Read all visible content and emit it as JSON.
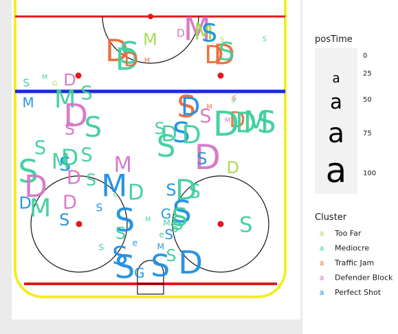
{
  "chart_data": {
    "type": "scatter",
    "title": "",
    "xlabel": "",
    "ylabel": "",
    "xlim": [
      -42.5,
      42.5
    ],
    "ylim": [
      0,
      100
    ],
    "grid": false,
    "legend_position": "right",
    "size_legend": {
      "title": "posTime",
      "breaks": [
        "0",
        "25",
        "50",
        "75",
        "100"
      ],
      "glyph": "a"
    },
    "color_legend": {
      "title": "Cluster",
      "glyph": "a",
      "entries": [
        {
          "name": "Too Far",
          "color": "#a3d94b"
        },
        {
          "name": "Mediocre",
          "color": "#3fcf9c"
        },
        {
          "name": "Traffic Jam",
          "color": "#ea6b37"
        },
        {
          "name": "Defender Block",
          "color": "#d575c6"
        },
        {
          "name": "Perfect Shot",
          "color": "#1f8ee0"
        }
      ]
    },
    "points": [
      {
        "x": -39.0,
        "y": 74.0,
        "label": "S",
        "cluster": "Mediocre",
        "posTime": 18
      },
      {
        "x": -33.2,
        "y": 75.8,
        "label": "M",
        "cluster": "Mediocre",
        "posTime": 4
      },
      {
        "x": -38.4,
        "y": 67.8,
        "label": "M",
        "cluster": "Perfect Shot",
        "posTime": 28
      },
      {
        "x": -25.3,
        "y": 75.0,
        "label": "D",
        "cluster": "Defender Block",
        "posTime": 38
      },
      {
        "x": -20.0,
        "y": 70.7,
        "label": "S",
        "cluster": "Mediocre",
        "posTime": 46
      },
      {
        "x": -26.8,
        "y": 69.0,
        "label": "M",
        "cluster": "Mediocre",
        "posTime": 68
      },
      {
        "x": -23.4,
        "y": 63.9,
        "label": "D",
        "cluster": "Defender Block",
        "posTime": 92
      },
      {
        "x": -18.0,
        "y": 60.2,
        "label": "S",
        "cluster": "Mediocre",
        "posTime": 78
      },
      {
        "x": -25.3,
        "y": 59.6,
        "label": "S",
        "cluster": "Defender Block",
        "posTime": 38
      },
      {
        "x": -34.6,
        "y": 53.7,
        "label": "S",
        "cluster": "Mediocre",
        "posTime": 46
      },
      {
        "x": -28.2,
        "y": 49.3,
        "label": "M",
        "cluster": "Mediocre",
        "posTime": 54
      },
      {
        "x": -26.8,
        "y": 48.5,
        "label": "S",
        "cluster": "Perfect Shot",
        "posTime": 46
      },
      {
        "x": -25.3,
        "y": 50.8,
        "label": "D",
        "cluster": "Mediocre",
        "posTime": 60
      },
      {
        "x": -20.0,
        "y": 51.4,
        "label": "S",
        "cluster": "Mediocre",
        "posTime": 46
      },
      {
        "x": -38.4,
        "y": 46.3,
        "label": "S",
        "cluster": "Mediocre",
        "posTime": 92
      },
      {
        "x": -36.0,
        "y": 41.5,
        "label": "D",
        "cluster": "Defender Block",
        "posTime": 86
      },
      {
        "x": -24.0,
        "y": 44.3,
        "label": "D",
        "cluster": "Defender Block",
        "posTime": 46
      },
      {
        "x": -18.6,
        "y": 43.7,
        "label": "S",
        "cluster": "Mediocre",
        "posTime": 38
      },
      {
        "x": -8.6,
        "y": 48.3,
        "label": "M",
        "cluster": "Defender Block",
        "posTime": 54
      },
      {
        "x": -11.3,
        "y": 41.7,
        "label": "M",
        "cluster": "Perfect Shot",
        "posTime": 86
      },
      {
        "x": -39.3,
        "y": 36.4,
        "label": "D",
        "cluster": "Perfect Shot",
        "posTime": 38
      },
      {
        "x": -34.6,
        "y": 34.9,
        "label": "M",
        "cluster": "Mediocre",
        "posTime": 68
      },
      {
        "x": -25.3,
        "y": 36.6,
        "label": "D",
        "cluster": "Defender Block",
        "posTime": 46
      },
      {
        "x": -27.0,
        "y": 31.2,
        "label": "S",
        "cluster": "Perfect Shot",
        "posTime": 38
      },
      {
        "x": -16.0,
        "y": 35.0,
        "label": "S",
        "cluster": "Perfect Shot",
        "posTime": 18
      },
      {
        "x": -4.5,
        "y": 39.6,
        "label": "D",
        "cluster": "Mediocre",
        "posTime": 54
      },
      {
        "x": -8.0,
        "y": 31.1,
        "label": "S",
        "cluster": "Perfect Shot",
        "posTime": 92
      },
      {
        "x": -9.3,
        "y": 27.0,
        "label": "S",
        "cluster": "Mediocre",
        "posTime": 38
      },
      {
        "x": -15.4,
        "y": 22.6,
        "label": "S",
        "cluster": "Mediocre",
        "posTime": 10
      },
      {
        "x": -9.5,
        "y": 20.0,
        "label": "S",
        "cluster": "Perfect Shot",
        "posTime": 68
      },
      {
        "x": -8.0,
        "y": 16.5,
        "label": "S",
        "cluster": "Perfect Shot",
        "posTime": 92
      },
      {
        "x": -4.8,
        "y": 24.0,
        "label": "e",
        "cluster": "Perfect Shot",
        "posTime": 10
      },
      {
        "x": -3.4,
        "y": 14.5,
        "label": "G",
        "cluster": "Perfect Shot",
        "posTime": 28
      },
      {
        "x": -0.7,
        "y": 31.2,
        "label": "M",
        "cluster": "Mediocre",
        "posTime": 4
      },
      {
        "x": -11.0,
        "y": 39.0,
        "label": "e",
        "cluster": "Mediocre",
        "posTime": 4
      },
      {
        "x": 0.0,
        "y": 87.6,
        "label": "M",
        "cluster": "Too Far",
        "posTime": 38
      },
      {
        "x": 9.6,
        "y": 89.6,
        "label": "D",
        "cluster": "Defender Block",
        "posTime": 18
      },
      {
        "x": 14.8,
        "y": 90.9,
        "label": "M",
        "cluster": "Defender Block",
        "posTime": 92
      },
      {
        "x": 16.8,
        "y": 90.1,
        "label": "M",
        "cluster": "Too Far",
        "posTime": 60
      },
      {
        "x": 18.6,
        "y": 89.7,
        "label": "S",
        "cluster": "Perfect Shot",
        "posTime": 68
      },
      {
        "x": 20.1,
        "y": 82.9,
        "label": "D",
        "cluster": "Traffic Jam",
        "posTime": 68
      },
      {
        "x": 23.3,
        "y": 82.9,
        "label": "D",
        "cluster": "Traffic Jam",
        "posTime": 78
      },
      {
        "x": 24.0,
        "y": 83.9,
        "label": "S",
        "cluster": "Mediocre",
        "posTime": 68
      },
      {
        "x": 22.6,
        "y": 87.5,
        "label": "S",
        "cluster": "Too Far",
        "posTime": 4
      },
      {
        "x": 36.0,
        "y": 87.6,
        "label": "S",
        "cluster": "Mediocre",
        "posTime": 4
      },
      {
        "x": -10.5,
        "y": 84.0,
        "label": "D",
        "cluster": "Traffic Jam",
        "posTime": 86
      },
      {
        "x": -6.6,
        "y": 83.2,
        "label": "S",
        "cluster": "Mediocre",
        "posTime": 86
      },
      {
        "x": -7.3,
        "y": 81.3,
        "label": "D",
        "cluster": "Mediocre",
        "posTime": 86
      },
      {
        "x": -6.0,
        "y": 81.2,
        "label": "D",
        "cluster": "Traffic Jam",
        "posTime": 46
      },
      {
        "x": -1.0,
        "y": 81.0,
        "label": "M",
        "cluster": "Traffic Jam",
        "posTime": 4
      },
      {
        "x": 11.4,
        "y": 66.4,
        "label": "S",
        "cluster": "Traffic Jam",
        "posTime": 86
      },
      {
        "x": 12.7,
        "y": 66.7,
        "label": "D",
        "cluster": "Perfect Shot",
        "posTime": 68
      },
      {
        "x": 17.4,
        "y": 63.5,
        "label": "S",
        "cluster": "Defender Block",
        "posTime": 46
      },
      {
        "x": 26.1,
        "y": 68.4,
        "label": "S",
        "cluster": "Mediocre",
        "posTime": 4
      },
      {
        "x": 27.4,
        "y": 62.3,
        "label": "D",
        "cluster": "Traffic Jam",
        "posTime": 54
      },
      {
        "x": 30.1,
        "y": 61.6,
        "label": "D",
        "cluster": "Mediocre",
        "posTime": 78
      },
      {
        "x": 33.3,
        "y": 61.6,
        "label": "M",
        "cluster": "Mediocre",
        "posTime": 86
      },
      {
        "x": 36.6,
        "y": 61.6,
        "label": "S",
        "cluster": "Mediocre",
        "posTime": 86
      },
      {
        "x": 23.9,
        "y": 61.2,
        "label": "D",
        "cluster": "Mediocre",
        "posTime": 100
      },
      {
        "x": 3.0,
        "y": 59.8,
        "label": "S",
        "cluster": "Mediocre",
        "posTime": 38
      },
      {
        "x": 6.0,
        "y": 57.8,
        "label": "D",
        "cluster": "Mediocre",
        "posTime": 54
      },
      {
        "x": 9.8,
        "y": 58.5,
        "label": "S",
        "cluster": "Perfect Shot",
        "posTime": 78
      },
      {
        "x": 13.0,
        "y": 57.8,
        "label": "D",
        "cluster": "Mediocre",
        "posTime": 68
      },
      {
        "x": 5.0,
        "y": 54.1,
        "label": "S",
        "cluster": "Mediocre",
        "posTime": 86
      },
      {
        "x": 18.0,
        "y": 50.8,
        "label": "D",
        "cluster": "Defender Block",
        "posTime": 100
      },
      {
        "x": 16.3,
        "y": 50.3,
        "label": "S",
        "cluster": "Perfect Shot",
        "posTime": 38
      },
      {
        "x": 26.0,
        "y": 47.5,
        "label": "D",
        "cluster": "Too Far",
        "posTime": 38
      },
      {
        "x": 11.3,
        "y": 40.5,
        "label": "D",
        "cluster": "Mediocre",
        "posTime": 78
      },
      {
        "x": 14.0,
        "y": 40.0,
        "label": "S",
        "cluster": "Mediocre",
        "posTime": 46
      },
      {
        "x": 6.6,
        "y": 40.5,
        "label": "S",
        "cluster": "Perfect Shot",
        "posTime": 38
      },
      {
        "x": 10.0,
        "y": 33.6,
        "label": "S",
        "cluster": "Perfect Shot",
        "posTime": 86
      },
      {
        "x": 9.3,
        "y": 32.0,
        "label": "S",
        "cluster": "Mediocre",
        "posTime": 68
      },
      {
        "x": 5.0,
        "y": 33.0,
        "label": "G",
        "cluster": "Perfect Shot",
        "posTime": 28
      },
      {
        "x": 5.2,
        "y": 30.2,
        "label": "M",
        "cluster": "Mediocre",
        "posTime": 10
      },
      {
        "x": 7.6,
        "y": 28.8,
        "label": "S",
        "cluster": "Mediocre",
        "posTime": 28
      },
      {
        "x": 8.6,
        "y": 30.0,
        "label": "S",
        "cluster": "Mediocre",
        "posTime": 46
      },
      {
        "x": 3.6,
        "y": 26.6,
        "label": "e",
        "cluster": "Mediocre",
        "posTime": 10
      },
      {
        "x": 5.9,
        "y": 26.6,
        "label": "S",
        "cluster": "Perfect Shot",
        "posTime": 28
      },
      {
        "x": 3.3,
        "y": 22.8,
        "label": "M",
        "cluster": "Perfect Shot",
        "posTime": 10
      },
      {
        "x": 6.6,
        "y": 20.0,
        "label": "S",
        "cluster": "Mediocre",
        "posTime": 38
      },
      {
        "x": 3.2,
        "y": 16.7,
        "label": "S",
        "cluster": "Perfect Shot",
        "posTime": 86
      },
      {
        "x": 12.7,
        "y": 17.9,
        "label": "D",
        "cluster": "Perfect Shot",
        "posTime": 92
      },
      {
        "x": 30.1,
        "y": 29.5,
        "label": "S",
        "cluster": "Mediocre",
        "posTime": 54
      },
      {
        "x": 24.3,
        "y": 62.3,
        "label": "M",
        "cluster": "Defender Block",
        "posTime": 4
      },
      {
        "x": 18.6,
        "y": 66.5,
        "label": "M",
        "cluster": "Traffic Jam",
        "posTime": 4
      },
      {
        "x": 26.5,
        "y": 69.1,
        "label": "S",
        "cluster": "Traffic Jam",
        "posTime": 4
      },
      {
        "x": -30.0,
        "y": 73.8,
        "label": "G",
        "cluster": "Too Far",
        "posTime": 4
      }
    ]
  }
}
